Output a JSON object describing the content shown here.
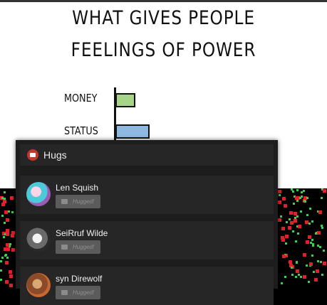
{
  "comic": {
    "title_line1": "WHAT GIVES PEOPLE",
    "title_line2": "FEELINGS OF POWER",
    "bars": [
      {
        "label": "MONEY",
        "color": "#a8d48a"
      },
      {
        "label": "STATUS",
        "color": "#8fb8e0"
      }
    ]
  },
  "hugs_panel": {
    "title": "Hugs",
    "icon": "thumbs-up-icon",
    "accent": "#c0392b",
    "entries": [
      {
        "name": "Len Squish",
        "button_label": "Hugged!"
      },
      {
        "name": "SeiRruf Wilde",
        "button_label": "Hugged!"
      },
      {
        "name": "syn Direwolf",
        "button_label": "Hugged!"
      }
    ]
  },
  "colors": {
    "panel_bg": "#1d1d1d",
    "entry_bg": "#262626",
    "button_bg": "#5b5b5b",
    "matrix_green": "#36d24a",
    "matrix_red": "#e0202a"
  }
}
